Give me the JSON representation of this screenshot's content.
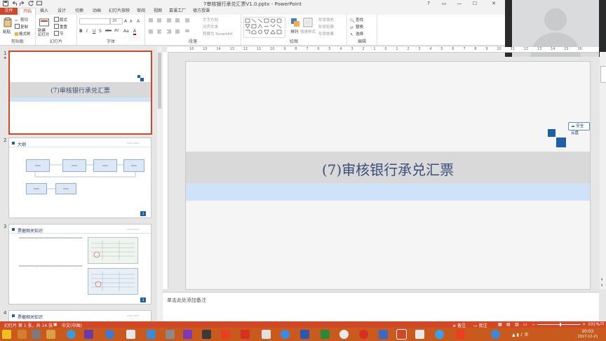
{
  "window": {
    "title": "7审核银行承兑汇票V1.0.pptx - PowerPoint",
    "qat": [
      "save",
      "undo",
      "redo",
      "refresh",
      "start-slideshow"
    ]
  },
  "tabs": [
    {
      "label": "文件"
    },
    {
      "label": "开始"
    },
    {
      "label": "插入"
    },
    {
      "label": "设计"
    },
    {
      "label": "切换"
    },
    {
      "label": "动画"
    },
    {
      "label": "幻灯片放映"
    },
    {
      "label": "审阅"
    },
    {
      "label": "视图"
    },
    {
      "label": "慕课工厂"
    },
    {
      "label": "德方授课"
    }
  ],
  "ribbon": {
    "clipboard": {
      "label": "剪贴板",
      "paste": "粘贴",
      "cut": "剪切",
      "copy": "复制",
      "format_painter": "格式刷"
    },
    "slides": {
      "label": "幻灯片",
      "new_slide": "新建\n幻灯片",
      "layout": "版式",
      "reset": "重置",
      "section": "节"
    },
    "font": {
      "label": "字体",
      "font_size": "20",
      "bold": "B",
      "italic": "I",
      "underline": "U",
      "strike": "S",
      "shadow": "abc",
      "spacing": "AV",
      "case": "Aa",
      "color": "A",
      "grow": "A",
      "shrink": "A",
      "clear": "A"
    },
    "paragraph": {
      "label": "段落",
      "text_direction": "文字方向",
      "align_text": "对齐文本",
      "smartart": "转换为 SmartArt"
    },
    "drawing": {
      "label": "绘图",
      "arrange": "排列",
      "quick_styles": "快速样式",
      "shape_fill": "形状填充",
      "shape_outline": "形状轮廓",
      "shape_effects": "形状效果"
    },
    "editing": {
      "label": "编辑",
      "find": "查找",
      "replace": "替换",
      "select": "选择"
    }
  },
  "ruler": [
    "16",
    "15",
    "14",
    "13",
    "12",
    "11",
    "10",
    "9",
    "8",
    "7",
    "6",
    "5",
    "4",
    "3",
    "2",
    "1",
    "0",
    "1",
    "2",
    "3",
    "4",
    "5",
    "6",
    "7",
    "8",
    "9",
    "10",
    "11",
    "12",
    "13",
    "14",
    "15",
    "16"
  ],
  "thumbnails": [
    {
      "num": "1",
      "title": "(7)审核银行承兑汇票"
    },
    {
      "num": "2",
      "title": "大纲",
      "page": "2",
      "header_right": "XXXX XXXX",
      "boxes": [
        "XXXX",
        "XXXX",
        "XXXX",
        "XXXX",
        "XXXX",
        "XXXX"
      ]
    },
    {
      "num": "3",
      "title": "票据相关知识",
      "page": "3",
      "header_right": "XXXX XXXX",
      "bullets": [
        "XXXXXXXXXXXXXXXXXXXXXXXXXXXXXXXXXXXXXXXXXXXX",
        "XXXXXXXXXXXXXXXXXXXXXXXXXXXXXXXXXXXXXXXXXXXX"
      ]
    },
    {
      "num": "4",
      "title": "票据相关知识",
      "header_right": "XXXX XXXX"
    }
  ],
  "slide": {
    "title": "(7)审核银行承兑汇票",
    "badge": "安全云盘"
  },
  "notes": {
    "placeholder": "单击此处添加备注"
  },
  "status": {
    "slide_info": "幻灯片 第 1 张，共 14 张",
    "language": "中文(中国)",
    "notes_btn": "备注",
    "comments_btn": "批注",
    "zoom": "101%"
  },
  "taskbar": {
    "time": "20:02",
    "date": "2017-12-21"
  },
  "colors": {
    "accent": "#d24726",
    "slide_band": "#d9d9d9",
    "slide_light": "#cfe2f7",
    "deco_blue": "#1f5fa8",
    "title_text": "#3b4f78"
  }
}
